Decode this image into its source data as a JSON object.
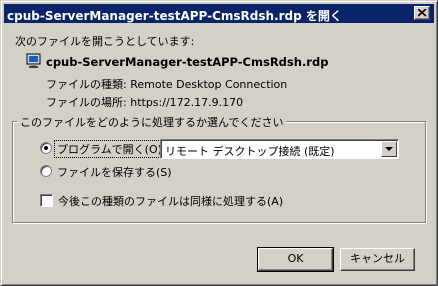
{
  "dialog": {
    "title": "cpub-ServerManager-testAPP-CmsRdsh.rdp を開く",
    "prompt": "次のファイルを開こうとしています:",
    "file_name": "cpub-ServerManager-testAPP-CmsRdsh.rdp",
    "file_type_label": "ファイルの種類:",
    "file_type": "Remote Desktop Connection",
    "file_location_label": "ファイルの場所:",
    "file_location": "https://172.17.9.170",
    "group_title": "このファイルをどのように処理するか選んでください",
    "open_with_label": "プログラムで開く(O):",
    "open_with_value": "リモート デスクトップ接続 (既定)",
    "save_label": "ファイルを保存する(S)",
    "always_label": "今後この種類のファイルは同様に処理する(A)",
    "ok_label": "OK",
    "cancel_label": "キャンセル",
    "selected_option": "open",
    "always_checked": false
  },
  "colors": {
    "titlebar": "#0a246a",
    "face": "#d4d0c8"
  },
  "icons": {
    "file": "rdp-file-icon",
    "close": "close-icon",
    "dropdown": "chevron-down-icon"
  }
}
